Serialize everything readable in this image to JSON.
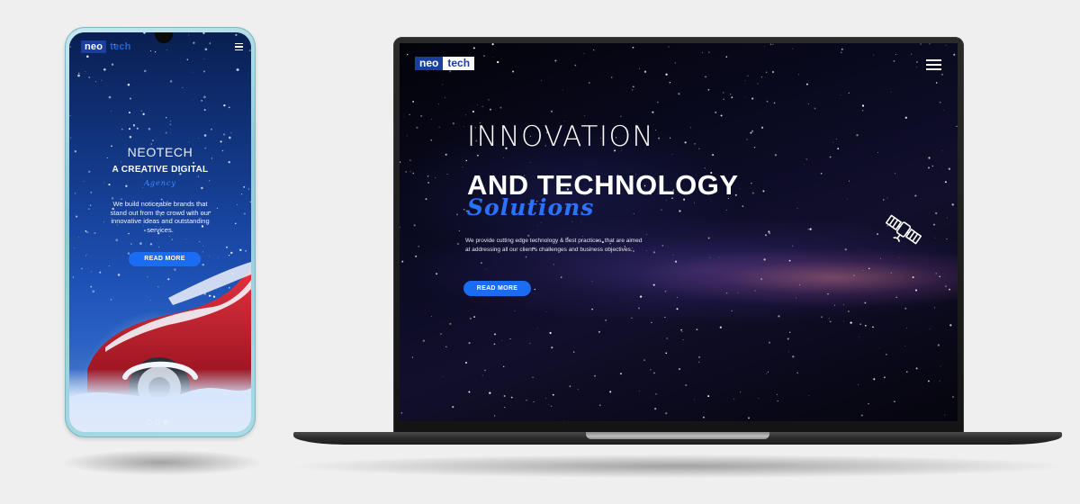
{
  "phone": {
    "logo": {
      "part1": "neo",
      "part2": "tech"
    },
    "title": "NEOTECH",
    "subtitle": "A CREATIVE DIGITAL",
    "script_word": "Agency",
    "description": "We build noticeable brands that stand out from the crowd with our innovative ideas and outstanding services.",
    "button_label": "READ MORE",
    "slider_dots": 3,
    "active_dot": 3
  },
  "laptop": {
    "logo": {
      "part1": "neo",
      "part2": "tech"
    },
    "headline_line1": "INNOVATION",
    "headline_line2": "AND TECHNOLOGY",
    "script_word": "Solutions",
    "description": "We provide cutting edge technology & best practices, that are aimed at addressing all our client's challenges and business objectives.",
    "button_label": "READ MORE"
  },
  "icons": [
    "hamburger-menu-icon",
    "satellite-icon"
  ],
  "colors": {
    "accent": "#1a6df3",
    "logo_blue": "#1a3f9e",
    "background": "#efefef"
  }
}
